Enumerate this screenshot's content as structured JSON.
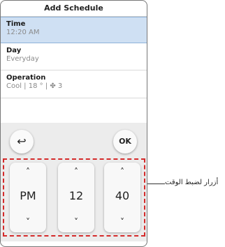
{
  "header": {
    "title": "Add Schedule"
  },
  "items": [
    {
      "label": "Time",
      "value": "12:20 AM"
    },
    {
      "label": "Day",
      "value": "Everyday"
    },
    {
      "label": "Operation",
      "value": "Cool  | 18 ° |  ✤ 3"
    }
  ],
  "buttons": {
    "back_icon": "↩",
    "ok": "OK"
  },
  "picker": {
    "up_icon": "˄",
    "down_icon": "˅",
    "columns": [
      {
        "value": "PM"
      },
      {
        "value": "12"
      },
      {
        "value": "40"
      }
    ]
  },
  "annotation": {
    "text": "أزرار لضبط الوقت"
  },
  "colors": {
    "highlight_row": "#cfe0f3",
    "dashed_box": "#d42a2a"
  }
}
